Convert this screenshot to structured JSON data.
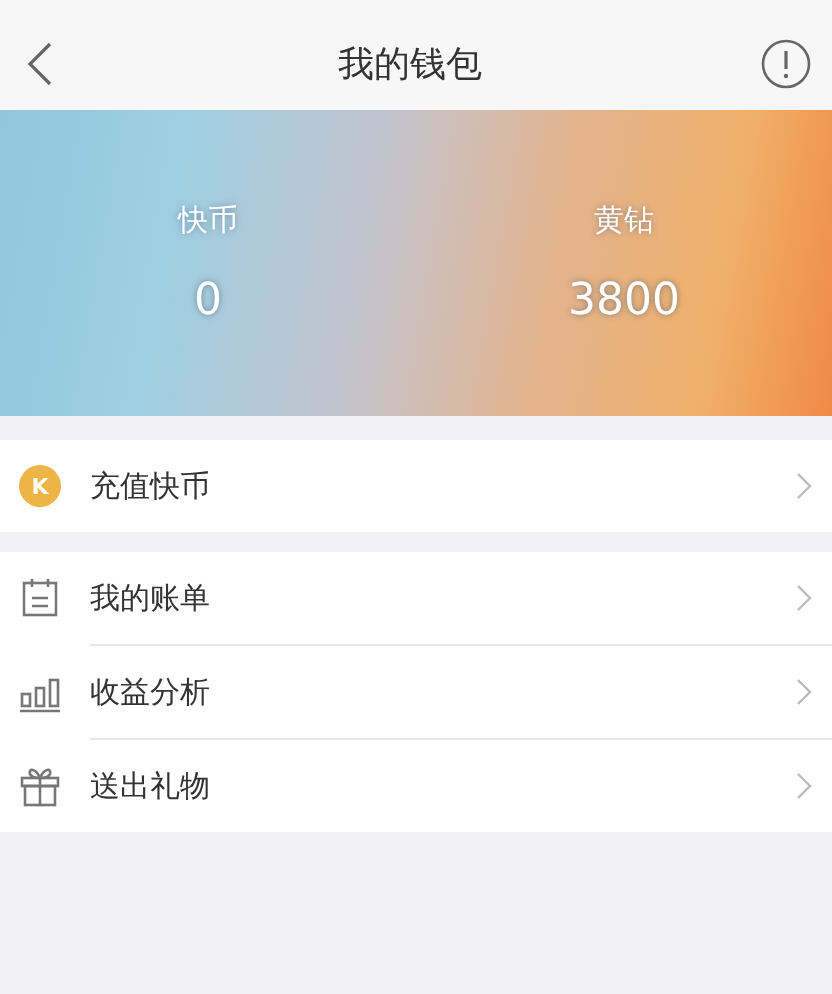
{
  "nav": {
    "title": "我的钱包"
  },
  "balances": [
    {
      "label": "快币",
      "value": "0"
    },
    {
      "label": "黄钻",
      "value": "3800"
    }
  ],
  "sections": [
    [
      {
        "kind": "coin",
        "icon_text": "K",
        "label": "充值快币"
      }
    ],
    [
      {
        "kind": "calendar",
        "label": "我的账单"
      },
      {
        "kind": "bars",
        "label": "收益分析"
      },
      {
        "kind": "gift",
        "label": "送出礼物"
      }
    ]
  ]
}
